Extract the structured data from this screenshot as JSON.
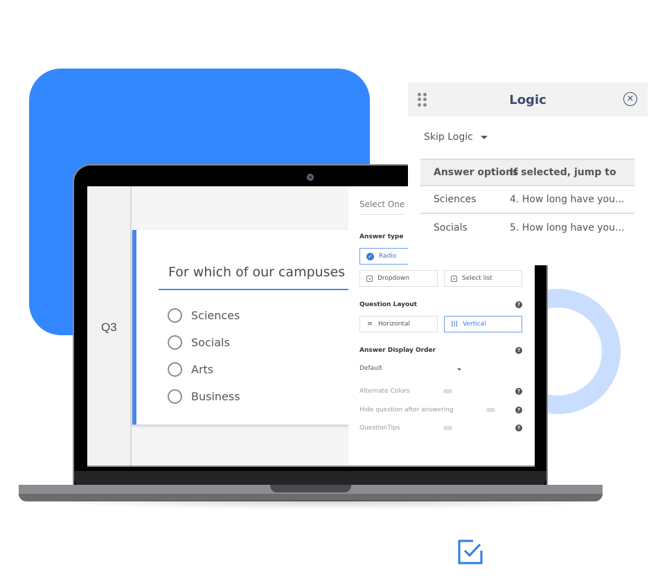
{
  "question": {
    "number": "Q3",
    "title": "For which of our campuses are",
    "options": [
      "Sciences",
      "Socials",
      "Arts",
      "Business"
    ]
  },
  "settings": {
    "question_type": "Select One",
    "answer_type_label": "Answer type",
    "answer_types": [
      {
        "label": "Radio",
        "icon": "check-circle-icon",
        "selected": true
      },
      {
        "label": "Dropdown",
        "icon": "dropdown-icon",
        "selected": false
      },
      {
        "label": "Select list",
        "icon": "dropdown-icon",
        "selected": false
      }
    ],
    "question_layout_label": "Question Layout",
    "layouts": [
      {
        "label": "Horizontal",
        "icon": "lines-icon",
        "selected": false
      },
      {
        "label": "Vertical",
        "icon": "columns-icon",
        "selected": true
      }
    ],
    "display_order_label": "Answer Display Order",
    "display_order_value": "Default",
    "toggles": [
      {
        "label": "Alternate Colors",
        "on": false
      },
      {
        "label": "Hide question after answering",
        "on": false
      },
      {
        "label": "QuestionTips",
        "on": false
      }
    ],
    "help_glyph": "?"
  },
  "logic": {
    "title": "Logic",
    "close_glyph": "×",
    "mode": "Skip Logic",
    "columns": [
      "Answer options",
      "If selected, jump to"
    ],
    "rows": [
      {
        "option": "Sciences",
        "target": "4. How long have you..."
      },
      {
        "option": "Socials",
        "target": "5. How long have you..."
      }
    ]
  },
  "colors": {
    "brand_blue": "#3388ff",
    "accent": "#4a86e8",
    "ring": "#c9deff",
    "logic_title": "#3c4a6e"
  }
}
